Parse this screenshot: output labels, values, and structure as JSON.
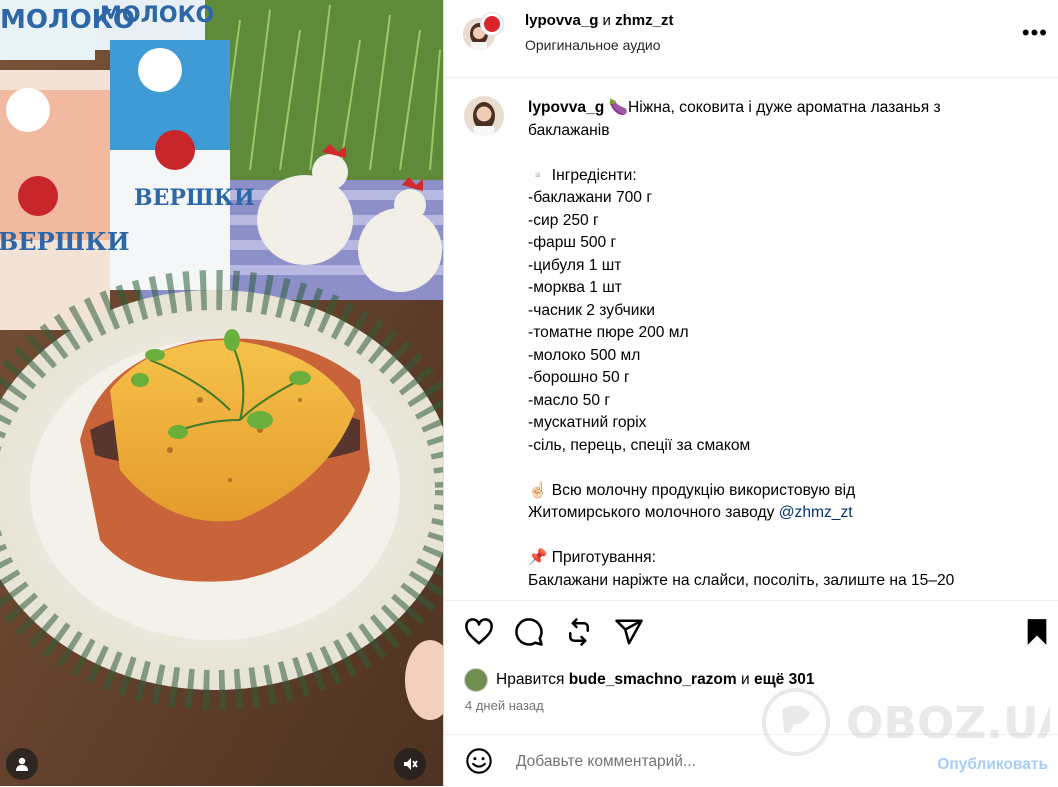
{
  "post": {
    "header": {
      "author1": "lypovva_g",
      "connector": "и",
      "author2": "zhmz_zt",
      "audio": "Оригинальное аудио",
      "more": "•••"
    },
    "caption": {
      "username": "lypovva_g",
      "emoji_title": "🍆",
      "title": "Ніжна, соковита і дуже ароматна лазанья з баклажанів",
      "ingredients_heading": "▫️ Інгредієнти:",
      "ingredients": [
        "-баклажани 700 г",
        "-сир 250 г",
        "-фарш 500 г",
        "-цибуля 1 шт",
        "-морква 1 шт",
        "-часник 2 зубчики",
        "-томатне пюре 200 мл",
        "-молоко 500 мл",
        "-борошно 50 г",
        "-масло 50 г",
        "-мускатний горіх",
        "-сіль, перець, спеції за смаком"
      ],
      "dairy_emoji": "☝🏻",
      "dairy_text_1": "Всю молочну продукцію використовую від",
      "dairy_text_2": "Житомирського молочного заводу",
      "dairy_mention": "@zhmz_zt",
      "prep_emoji": "📌",
      "prep_heading": "Приготування:",
      "prep_text": "Баклажани наріжте на слайси, посоліть, залиште на 15–20"
    },
    "likes": {
      "prefix": "Нравится",
      "user": "bude_smachno_razom",
      "middle": "и",
      "rest": "ещё 301"
    },
    "time": "4 дней назад",
    "comment": {
      "placeholder": "Добавьте комментарий...",
      "publish": "Опубликовать"
    },
    "media": {
      "carton1_brand": "МОЛОКО",
      "carton2_brand": "МОЛОКО",
      "carton3_label": "ВЕРШКИ",
      "carton4_label": "ВЕРШКИ"
    },
    "watermark": "OBOZ.UA",
    "icons": [
      "heart-icon",
      "comment-icon",
      "repost-icon",
      "share-icon",
      "bookmark-icon",
      "user-icon",
      "mute-icon",
      "emoji-icon"
    ]
  }
}
